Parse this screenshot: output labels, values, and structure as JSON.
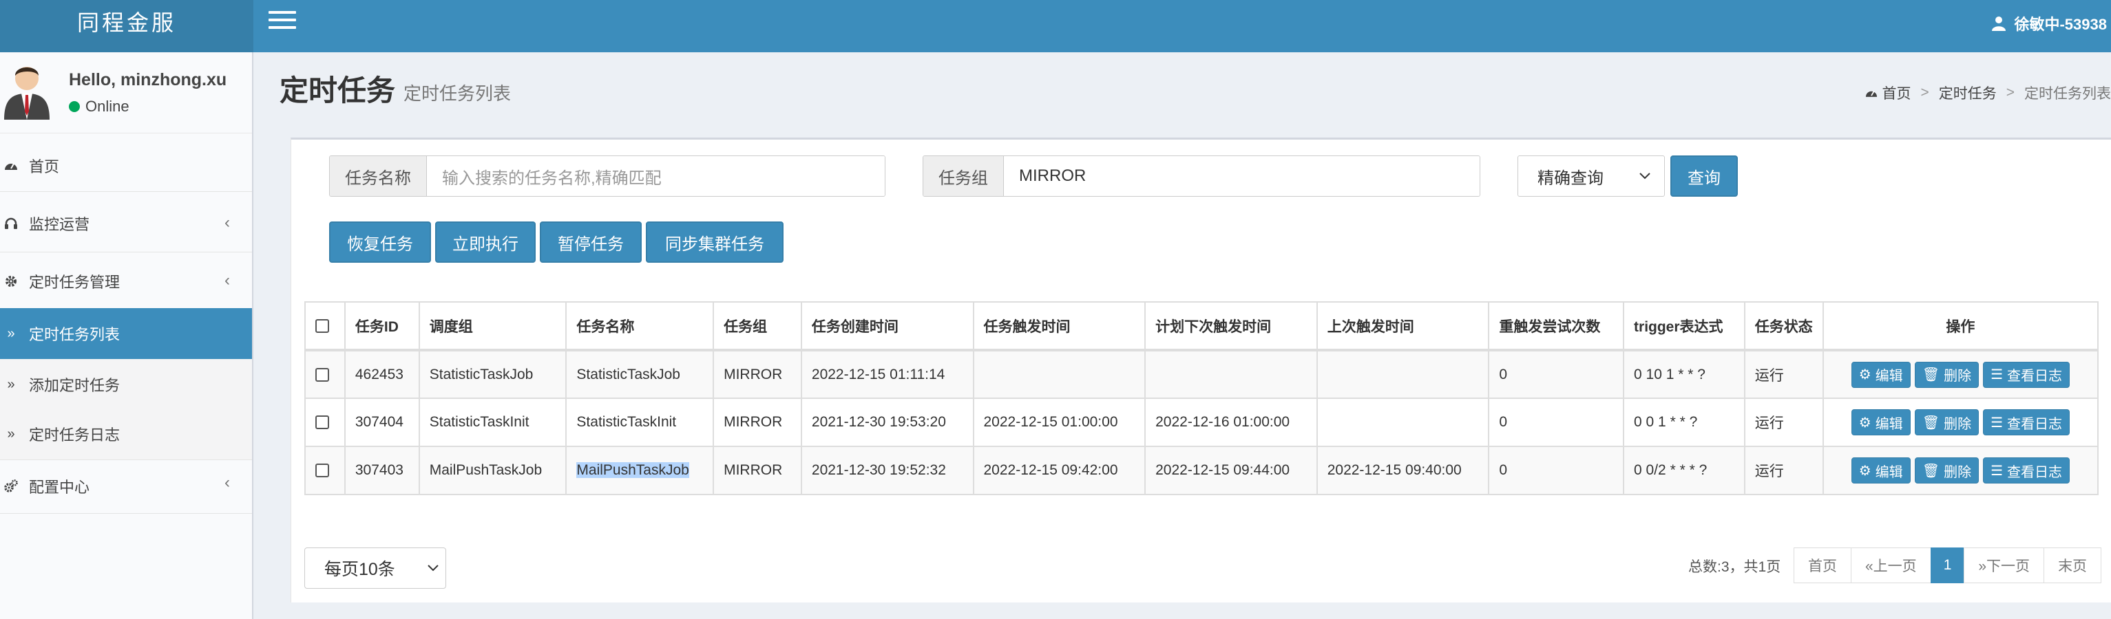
{
  "app": {
    "logo": "同程金服",
    "current_user": "徐敏中-53938"
  },
  "sidebar": {
    "hello": "Hello, minzhong.xu",
    "status": "Online",
    "items": [
      {
        "label": "首页",
        "icon": "dashboard-icon"
      },
      {
        "label": "监控运营",
        "icon": "headset-icon"
      },
      {
        "label": "定时任务管理",
        "icon": "gear-icon"
      },
      {
        "label": "定时任务列表",
        "icon": "double-chevron-icon",
        "active": true
      },
      {
        "label": "添加定时任务",
        "icon": "double-chevron-icon"
      },
      {
        "label": "定时任务日志",
        "icon": "double-chevron-icon"
      },
      {
        "label": "配置中心",
        "icon": "gears-icon"
      }
    ]
  },
  "page": {
    "title": "定时任务",
    "subtitle": "定时任务列表"
  },
  "breadcrumb": {
    "home": "首页",
    "level1": "定时任务",
    "current": "定时任务列表"
  },
  "search": {
    "task_name_label": "任务名称",
    "task_name_placeholder": "输入搜索的任务名称,精确匹配",
    "task_group_label": "任务组",
    "task_group_value": "MIRROR",
    "mode_selected": "精确查询",
    "query_button": "查询"
  },
  "actions": {
    "resume": "恢复任务",
    "run_now": "立即执行",
    "pause": "暂停任务",
    "sync": "同步集群任务"
  },
  "table": {
    "headers": [
      "任务ID",
      "调度组",
      "任务名称",
      "任务组",
      "任务创建时间",
      "任务触发时间",
      "计划下次触发时间",
      "上次触发时间",
      "重触发尝试次数",
      "trigger表达式",
      "任务状态",
      "操作"
    ],
    "rows": [
      {
        "id": "462453",
        "sched_group": "StatisticTaskJob",
        "name": "StatisticTaskJob",
        "group": "MIRROR",
        "created": "2022-12-15 01:11:14",
        "fire": "",
        "next": "",
        "prev": "",
        "retries": "0",
        "trigger": "0 10 1 * * ?",
        "status": "运行"
      },
      {
        "id": "307404",
        "sched_group": "StatisticTaskInit",
        "name": "StatisticTaskInit",
        "group": "MIRROR",
        "created": "2021-12-30 19:53:20",
        "fire": "2022-12-15 01:00:00",
        "next": "2022-12-16 01:00:00",
        "prev": "",
        "retries": "0",
        "trigger": "0 0 1 * * ?",
        "status": "运行"
      },
      {
        "id": "307403",
        "sched_group": "MailPushTaskJob",
        "name": "MailPushTaskJob",
        "group": "MIRROR",
        "created": "2021-12-30 19:52:32",
        "fire": "2022-12-15 09:42:00",
        "next": "2022-12-15 09:44:00",
        "prev": "2022-12-15 09:40:00",
        "retries": "0",
        "trigger": "0 0/2 * * * ?",
        "status": "运行"
      }
    ],
    "op_labels": {
      "edit": "编辑",
      "delete": "删除",
      "log": "查看日志"
    }
  },
  "footer": {
    "page_size": "每页10条",
    "total": "总数:3，共1页",
    "pager": {
      "first": "首页",
      "prev": "«上一页",
      "current": "1",
      "next": "»下一页",
      "last": "末页"
    }
  }
}
